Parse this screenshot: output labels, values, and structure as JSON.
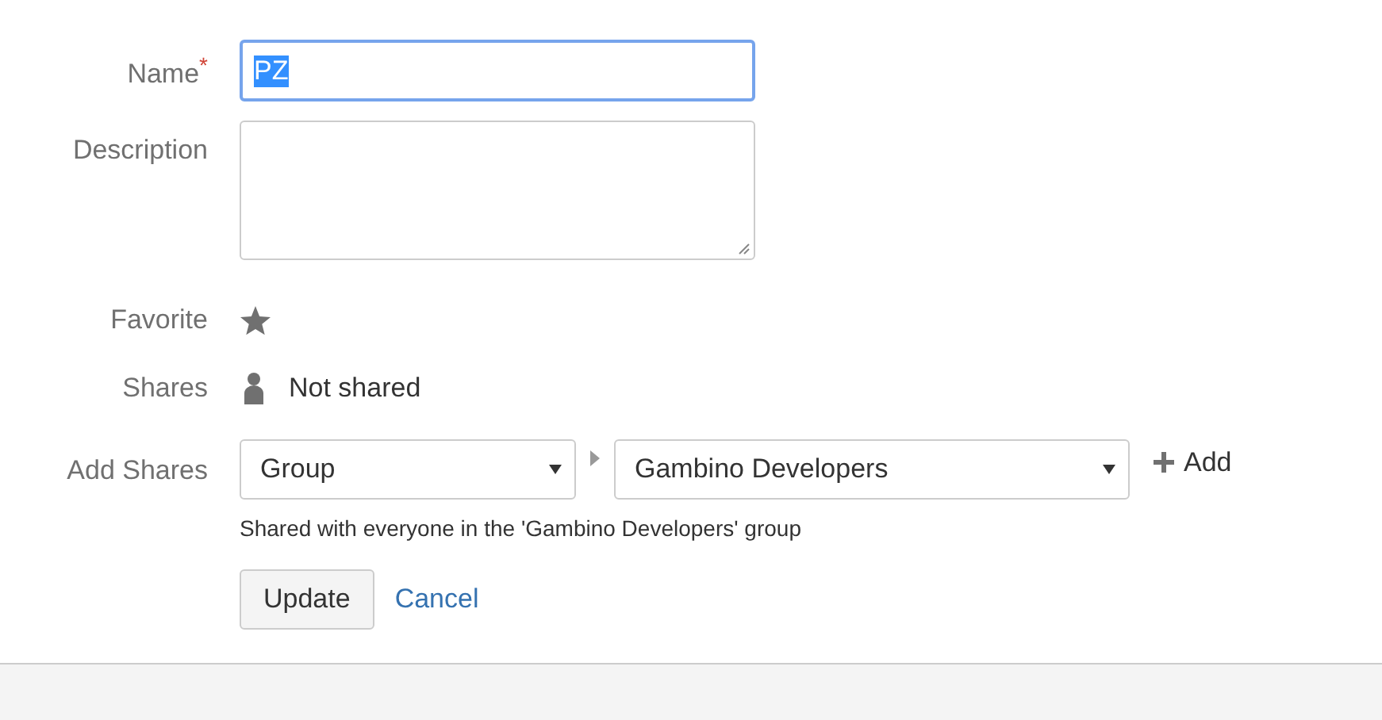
{
  "form": {
    "name": {
      "label": "Name",
      "required_mark": "*",
      "value": "PZ"
    },
    "description": {
      "label": "Description"
    },
    "favorite": {
      "label": "Favorite"
    },
    "shares": {
      "label": "Shares",
      "value": "Not shared"
    },
    "add_shares": {
      "label": "Add Shares",
      "type_select": "Group",
      "group_select": "Gambino Developers",
      "add_button": "Add",
      "help": "Shared with everyone in the 'Gambino Developers' group"
    },
    "buttons": [
      {
        "kind": "primary",
        "label": "Update"
      },
      {
        "kind": "link",
        "label": "Cancel"
      }
    ]
  }
}
